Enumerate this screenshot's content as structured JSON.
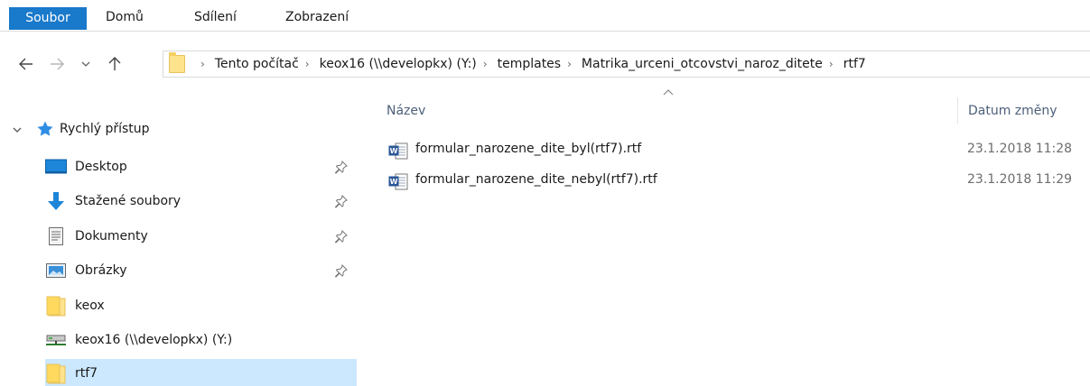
{
  "ribbon": {
    "tabs": [
      "Soubor",
      "Domů",
      "Sdílení",
      "Zobrazení"
    ]
  },
  "address": {
    "crumbs": [
      "Tento počítač",
      "keox16 (\\\\developkx) (Y:)",
      "templates",
      "Matrika_urceni_otcovstvi_naroz_ditete",
      "rtf7"
    ]
  },
  "nav": {
    "quick_access": "Rychlý přístup",
    "items": [
      {
        "label": "Desktop",
        "icon": "desktop-icon",
        "pinned": true
      },
      {
        "label": "Stažené soubory",
        "icon": "download-icon",
        "pinned": true
      },
      {
        "label": "Dokumenty",
        "icon": "documents-icon",
        "pinned": true
      },
      {
        "label": "Obrázky",
        "icon": "pictures-icon",
        "pinned": true
      },
      {
        "label": "keox",
        "icon": "folder-icon",
        "pinned": false
      },
      {
        "label": "keox16 (\\\\developkx) (Y:)",
        "icon": "network-drive-icon",
        "pinned": false
      },
      {
        "label": "rtf7",
        "icon": "folder-icon",
        "pinned": false,
        "selected": true
      }
    ]
  },
  "files": {
    "columns": {
      "name": "Název",
      "date": "Datum změny"
    },
    "rows": [
      {
        "name": "formular_narozene_dite_byl(rtf7).rtf",
        "date": "23.1.2018 11:28"
      },
      {
        "name": "formular_narozene_dite_nebyl(rtf7).rtf",
        "date": "23.1.2018 11:29"
      }
    ]
  },
  "colors": {
    "file_tab": "#1979ca",
    "selection": "#cce8ff",
    "column_header": "#4c607a"
  }
}
